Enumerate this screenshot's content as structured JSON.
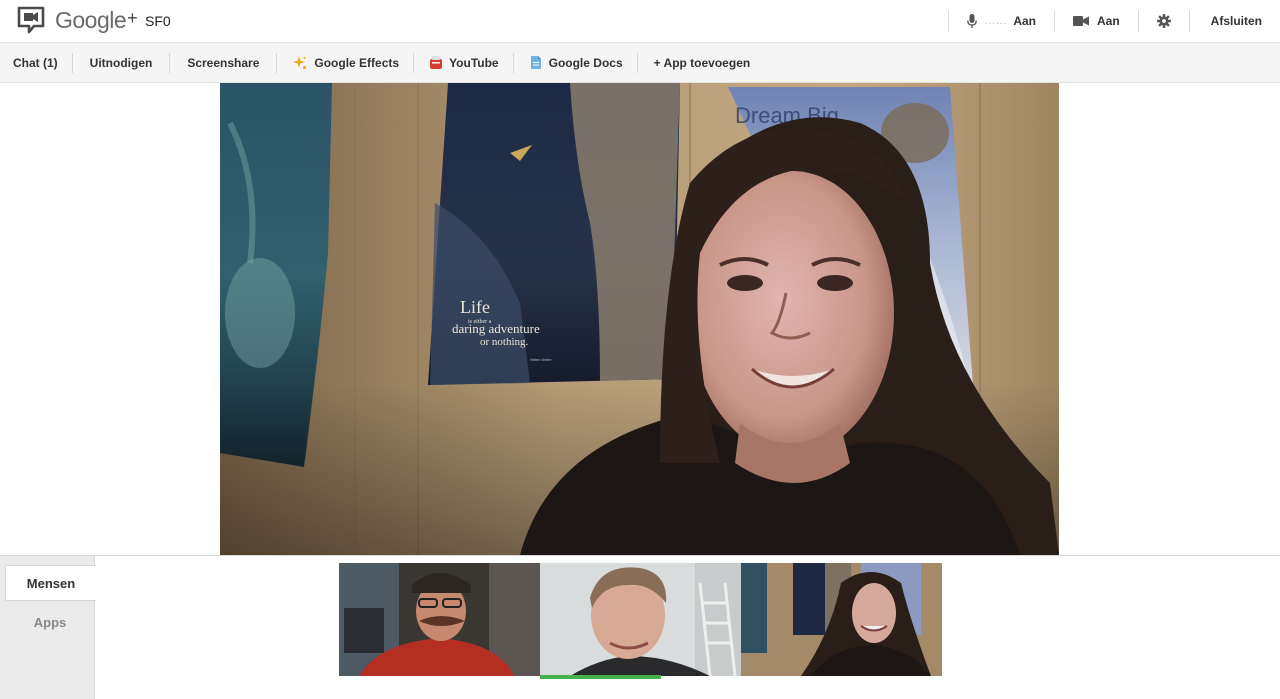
{
  "app": {
    "brand": "Google",
    "brand_plus": "+",
    "room_name": "SF0"
  },
  "top_right": {
    "mic_level": "......",
    "mic_label": "Aan",
    "camera_label": "Aan",
    "leave_label": "Afsluiten"
  },
  "toolbar": {
    "chat": "Chat (1)",
    "invite": "Uitnodigen",
    "screenshare": "Screenshare",
    "effects": "Google Effects",
    "youtube": "YouTube",
    "docs": "Google Docs",
    "add_app": "+ App toevoegen"
  },
  "main_video": {
    "poster_text_line1": "Life",
    "poster_text_line2": "is either a",
    "poster_text_line3": "daring adventure",
    "poster_text_line4": "or nothing.",
    "poster_text_author": "Helen Keller",
    "poster2_text": "Dream Big"
  },
  "side_tabs": {
    "people": "Mensen",
    "apps": "Apps"
  },
  "colors": {
    "speaking_indicator": "#46b04a",
    "toolbar_bg": "#f5f5f5"
  }
}
